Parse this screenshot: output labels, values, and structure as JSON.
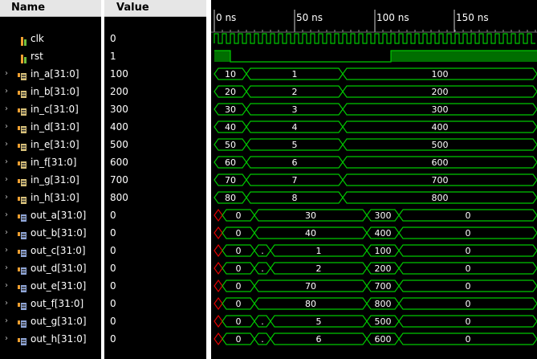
{
  "header": {
    "name_label": "Name",
    "value_label": "Value"
  },
  "timeline": {
    "markers": [
      "0 ns",
      "50 ns",
      "100 ns",
      "150 ns"
    ]
  },
  "colors": {
    "wave": "#00c800",
    "x_state": "#e00000",
    "value_text": "#ffffff",
    "background": "#000000"
  },
  "signals": [
    {
      "name": "clk",
      "value": "0",
      "kind": "bit",
      "icon": "bit-signal-icon"
    },
    {
      "name": "rst",
      "value": "1",
      "kind": "bit",
      "icon": "bit-signal-icon"
    },
    {
      "name": "in_a[31:0]",
      "value": "100",
      "kind": "bus",
      "icon": "bus-input-icon",
      "segments": [
        {
          "label": "10"
        },
        {
          "label": "1"
        },
        {
          "label": "100"
        }
      ]
    },
    {
      "name": "in_b[31:0]",
      "value": "200",
      "kind": "bus",
      "icon": "bus-input-icon",
      "segments": [
        {
          "label": "20"
        },
        {
          "label": "2"
        },
        {
          "label": "200"
        }
      ]
    },
    {
      "name": "in_c[31:0]",
      "value": "300",
      "kind": "bus",
      "icon": "bus-input-icon",
      "segments": [
        {
          "label": "30"
        },
        {
          "label": "3"
        },
        {
          "label": "300"
        }
      ]
    },
    {
      "name": "in_d[31:0]",
      "value": "400",
      "kind": "bus",
      "icon": "bus-input-icon",
      "segments": [
        {
          "label": "40"
        },
        {
          "label": "4"
        },
        {
          "label": "400"
        }
      ]
    },
    {
      "name": "in_e[31:0]",
      "value": "500",
      "kind": "bus",
      "icon": "bus-input-icon",
      "segments": [
        {
          "label": "50"
        },
        {
          "label": "5"
        },
        {
          "label": "500"
        }
      ]
    },
    {
      "name": "in_f[31:0]",
      "value": "600",
      "kind": "bus",
      "icon": "bus-input-icon",
      "segments": [
        {
          "label": "60"
        },
        {
          "label": "6"
        },
        {
          "label": "600"
        }
      ]
    },
    {
      "name": "in_g[31:0]",
      "value": "700",
      "kind": "bus",
      "icon": "bus-input-icon",
      "segments": [
        {
          "label": "70"
        },
        {
          "label": "7"
        },
        {
          "label": "700"
        }
      ]
    },
    {
      "name": "in_h[31:0]",
      "value": "800",
      "kind": "bus",
      "icon": "bus-input-icon",
      "segments": [
        {
          "label": "80"
        },
        {
          "label": "8"
        },
        {
          "label": "800"
        }
      ]
    },
    {
      "name": "out_a[31:0]",
      "value": "0",
      "kind": "bus",
      "icon": "bus-output-icon",
      "segments": [
        {
          "label": "",
          "x_state": true
        },
        {
          "label": "0"
        },
        {
          "label": "30"
        },
        {
          "label": "300"
        },
        {
          "label": "0"
        }
      ]
    },
    {
      "name": "out_b[31:0]",
      "value": "0",
      "kind": "bus",
      "icon": "bus-output-icon",
      "segments": [
        {
          "label": "",
          "x_state": true
        },
        {
          "label": "0"
        },
        {
          "label": "40"
        },
        {
          "label": "400"
        },
        {
          "label": "0"
        }
      ]
    },
    {
      "name": "out_c[31:0]",
      "value": "0",
      "kind": "bus",
      "icon": "bus-output-icon",
      "segments": [
        {
          "label": "",
          "x_state": true
        },
        {
          "label": "0"
        },
        {
          "label": "."
        },
        {
          "label": "1"
        },
        {
          "label": "100"
        },
        {
          "label": "0"
        }
      ]
    },
    {
      "name": "out_d[31:0]",
      "value": "0",
      "kind": "bus",
      "icon": "bus-output-icon",
      "segments": [
        {
          "label": "",
          "x_state": true
        },
        {
          "label": "0"
        },
        {
          "label": "."
        },
        {
          "label": "2"
        },
        {
          "label": "200"
        },
        {
          "label": "0"
        }
      ]
    },
    {
      "name": "out_e[31:0]",
      "value": "0",
      "kind": "bus",
      "icon": "bus-output-icon",
      "segments": [
        {
          "label": "",
          "x_state": true
        },
        {
          "label": "0"
        },
        {
          "label": "70"
        },
        {
          "label": "700"
        },
        {
          "label": "0"
        }
      ]
    },
    {
      "name": "out_f[31:0]",
      "value": "0",
      "kind": "bus",
      "icon": "bus-output-icon",
      "segments": [
        {
          "label": "",
          "x_state": true
        },
        {
          "label": "0"
        },
        {
          "label": "80"
        },
        {
          "label": "800"
        },
        {
          "label": "0"
        }
      ]
    },
    {
      "name": "out_g[31:0]",
      "value": "0",
      "kind": "bus",
      "icon": "bus-output-icon",
      "segments": [
        {
          "label": "",
          "x_state": true
        },
        {
          "label": "0"
        },
        {
          "label": "."
        },
        {
          "label": "5"
        },
        {
          "label": "500"
        },
        {
          "label": "0"
        }
      ]
    },
    {
      "name": "out_h[31:0]",
      "value": "0",
      "kind": "bus",
      "icon": "bus-output-icon",
      "segments": [
        {
          "label": "",
          "x_state": true
        },
        {
          "label": "0"
        },
        {
          "label": "."
        },
        {
          "label": "6"
        },
        {
          "label": "600"
        },
        {
          "label": "0"
        }
      ]
    }
  ]
}
